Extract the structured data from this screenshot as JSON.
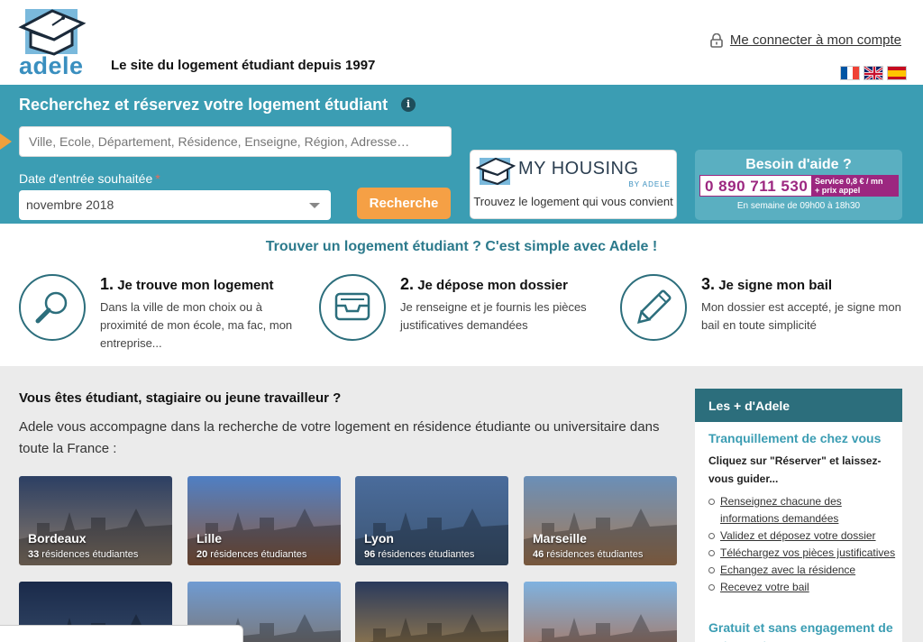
{
  "header": {
    "logo_text": "adele",
    "tagline": "Le site du logement étudiant depuis 1997",
    "login_label": "Me connecter à mon compte",
    "flags": [
      "fr-flag",
      "uk-flag",
      "es-flag"
    ]
  },
  "search": {
    "title": "Recherchez et réservez votre logement étudiant",
    "info_icon": "i",
    "placeholder": "Ville, Ecole, Département, Résidence, Enseigne, Région, Adresse…",
    "date_label": "Date d'entrée souhaitée",
    "required_mark": "*",
    "date_value": "novembre 2018",
    "search_button": "Recherche"
  },
  "myhousing": {
    "title_my": "MY",
    "title_housing": "HOUSING",
    "by": "BY ADELE",
    "caption": "Trouvez le logement qui vous convient"
  },
  "help": {
    "title": "Besoin d'aide ?",
    "phone": "0 890 711 530",
    "service_line1": "Service   0,8 € / mn",
    "service_line2": "+ prix appel",
    "hours": "En semaine de 09h00 à 18h30"
  },
  "steps": {
    "title": "Trouver un logement étudiant ? C'est simple avec Adele !",
    "items": [
      {
        "num": "1.",
        "title": "Je trouve mon logement",
        "text": "Dans la ville de mon choix ou à proximité de mon école, ma fac, mon entreprise...",
        "icon": "magnifier-icon"
      },
      {
        "num": "2.",
        "title": "Je dépose mon dossier",
        "text": "Je renseigne et je fournis les pièces justificatives demandées",
        "icon": "inbox-tray-icon"
      },
      {
        "num": "3.",
        "title": "Je signe mon bail",
        "text": "Mon dossier est accepté, je signe mon bail en toute simplicité",
        "icon": "pencil-icon"
      }
    ]
  },
  "intro": {
    "title": "Vous êtes étudiant, stagiaire ou jeune travailleur ?",
    "text": "Adele vous accompagne dans la recherche de votre logement en résidence étudiante ou universitaire dans toute la France :"
  },
  "cities": [
    {
      "name": "Bordeaux",
      "count": "33",
      "suffix": " résidences étudiantes",
      "color_top": "#2c3f63",
      "color_bottom": "#8a7a6a"
    },
    {
      "name": "Lille",
      "count": "20",
      "suffix": " résidences étudiantes",
      "color_top": "#4f7fc4",
      "color_bottom": "#8b5a3e"
    },
    {
      "name": "Lyon",
      "count": "96",
      "suffix": " résidences étudiantes",
      "color_top": "#4a6c9c",
      "color_bottom": "#3d5572"
    },
    {
      "name": "Marseille",
      "count": "46",
      "suffix": " résidences étudiantes",
      "color_top": "#6a8fb8",
      "color_bottom": "#a67a55"
    },
    {
      "name": "",
      "count": "",
      "suffix": "",
      "color_top": "#1a2a4a",
      "color_bottom": "#3c5270"
    },
    {
      "name": "",
      "count": "",
      "suffix": "",
      "color_top": "#6f9bd2",
      "color_bottom": "#7e6a58"
    },
    {
      "name": "",
      "count": "",
      "suffix": "",
      "color_top": "#2a3a5c",
      "color_bottom": "#b08a4a"
    },
    {
      "name": "",
      "count": "",
      "suffix": "",
      "color_top": "#7fb2e0",
      "color_bottom": "#b06a46"
    }
  ],
  "side": {
    "header": "Les + d'Adele",
    "h2": "Tranquillement de chez vous",
    "p": "Cliquez sur \"Réserver\" et laissez-vous guider...",
    "list": [
      "Renseignez chacune des informations demandées",
      "Validez et déposez votre dossier",
      "Téléchargez vos pièces justificatives",
      "Echangez avec la résidence",
      "Recevez votre bail"
    ],
    "h3": "Gratuit et sans engagement de votre part"
  },
  "colors": {
    "band": "#3b9db3",
    "accent_orange": "#f5a045",
    "help_magenta": "#9c2780",
    "dark_teal": "#2c6e7c"
  }
}
